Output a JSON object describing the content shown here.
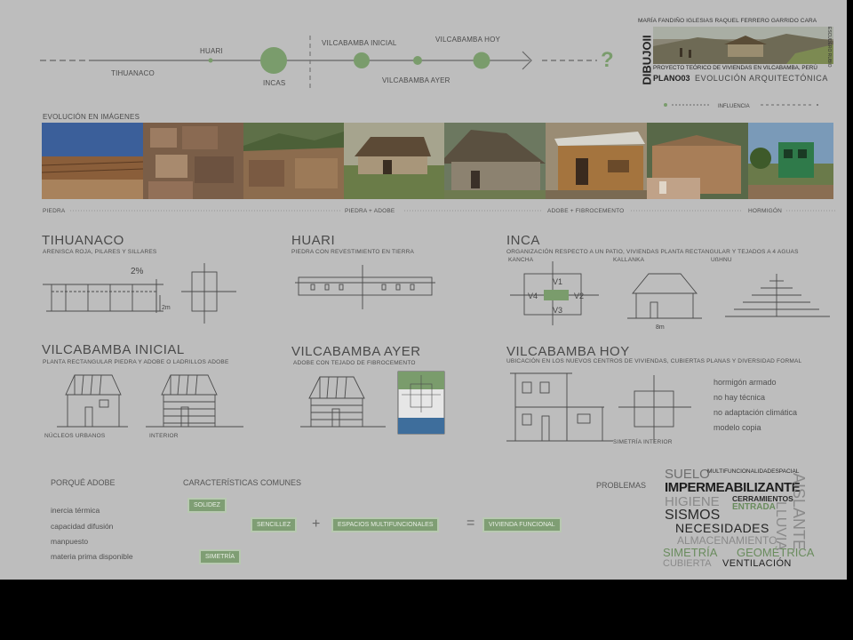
{
  "timeline": {
    "tihuanaco": "TIHUANACO",
    "huari": "HUARI",
    "incas": "INCAS",
    "vilca_inicial": "VILCABAMBA INICIAL",
    "vilca_ayer": "VILCABAMBA AYER",
    "vilca_hoy": "VILCABAMBA HOY",
    "question": "?"
  },
  "title_block": {
    "authors": "MARÍA FANDIÑO IGLESIAS RAQUEL FERRERO GARRIDO CARA",
    "course": "DIBUJOII",
    "side_credit": "ESCUDERO RUBIO",
    "project": "PROYECTO TEÓRICO DE VIVIENDAS EN VILCABAMBA, PERÚ",
    "plan": "PLANO03",
    "plan_title": "EVOLUCIÓN ARQUITECTÓNICA",
    "legend": "INFLUENCIA"
  },
  "images_section": {
    "title": "EVOLUCIÓN EN IMÁGENES",
    "labels": [
      "PIEDRA",
      "PIEDRA + ADOBE",
      "ADOBE + FIBROCEMENTO",
      "HORMIGÓN"
    ]
  },
  "sections": {
    "tihuanaco": {
      "title": "TIHUANACO",
      "sub": "ARENISCA ROJA, PILARES Y SILLARES",
      "slope": "2%",
      "height": "2m"
    },
    "huari": {
      "title": "HUARI",
      "sub": "PIEDRA CON REVESTIMIENTO EN TIERRA"
    },
    "inca": {
      "title": "INCA",
      "sub": "ORGANIZACIÓN RESPECTO A UN PATIO, VIVIENDAS PLANTA RECTANGULAR Y TEJADOS A 4 AGUAS",
      "types": [
        "KANCHA",
        "KALLANKA",
        "UßHNU"
      ],
      "v1": "V1",
      "v2": "V2",
      "v3": "V3",
      "v4": "V4",
      "width": "8m"
    },
    "vilca_inicial": {
      "title": "VILCABAMBA INICIAL",
      "sub": "PLANTA RECTANGULAR PIEDRA Y ADOBE O LADRILLOS ADOBE",
      "labels": [
        "NÚCLEOS URBANOS",
        "INTERIOR"
      ]
    },
    "vilca_ayer": {
      "title": "VILCABAMBA AYER",
      "sub": "ADOBE CON TEJADO DE FIBROCEMENTO"
    },
    "vilca_hoy": {
      "title": "VILCABAMBA HOY",
      "sub": "UBICACIÓN EN LOS NUEVOS CENTROS DE VIVIENDAS, CUBIERTAS PLANAS Y DIVERSIDAD FORMAL",
      "label": "SIMETRÍA INTERIOR",
      "list": [
        "hormigón armado",
        "no hay técnica",
        "no adaptación climática",
        "modelo copia"
      ]
    }
  },
  "porque": {
    "title": "PORQUÉ ADOBE",
    "items": [
      "inercia térmica",
      "capacidad difusión",
      "manpuesto",
      "materia prima disponible"
    ]
  },
  "caracteristicas": {
    "title": "CARACTERÍSTICAS COMUNES",
    "tags": [
      "SOLIDEZ",
      "SENCILLEZ",
      "SIMETRÍA",
      "ESPACIOS MULTIFUNCIONALES",
      "VIVIENDA FUNCIONAL"
    ],
    "plus": "+",
    "equals": "="
  },
  "problemas": {
    "title": "PROBLEMAS",
    "words": [
      "SUELO",
      "MULTIFUNCIONALIDADESPACIAL",
      "IMPERMEABILIZANTE",
      "HIGIENE",
      "CERRAMIENTOS",
      "ENTRADA",
      "SISMOS",
      "NECESIDADES",
      "ALMACENAMIENTO",
      "SIMETRÍA",
      "GEOMÉTRICA",
      "CUBIERTA",
      "VENTILACIÓN",
      "AISLANTE",
      "LLUVIA"
    ]
  },
  "colors": {
    "accent": "#7a9c6c",
    "sheet": "#bdbdbd",
    "ink": "#4a4a4a"
  }
}
